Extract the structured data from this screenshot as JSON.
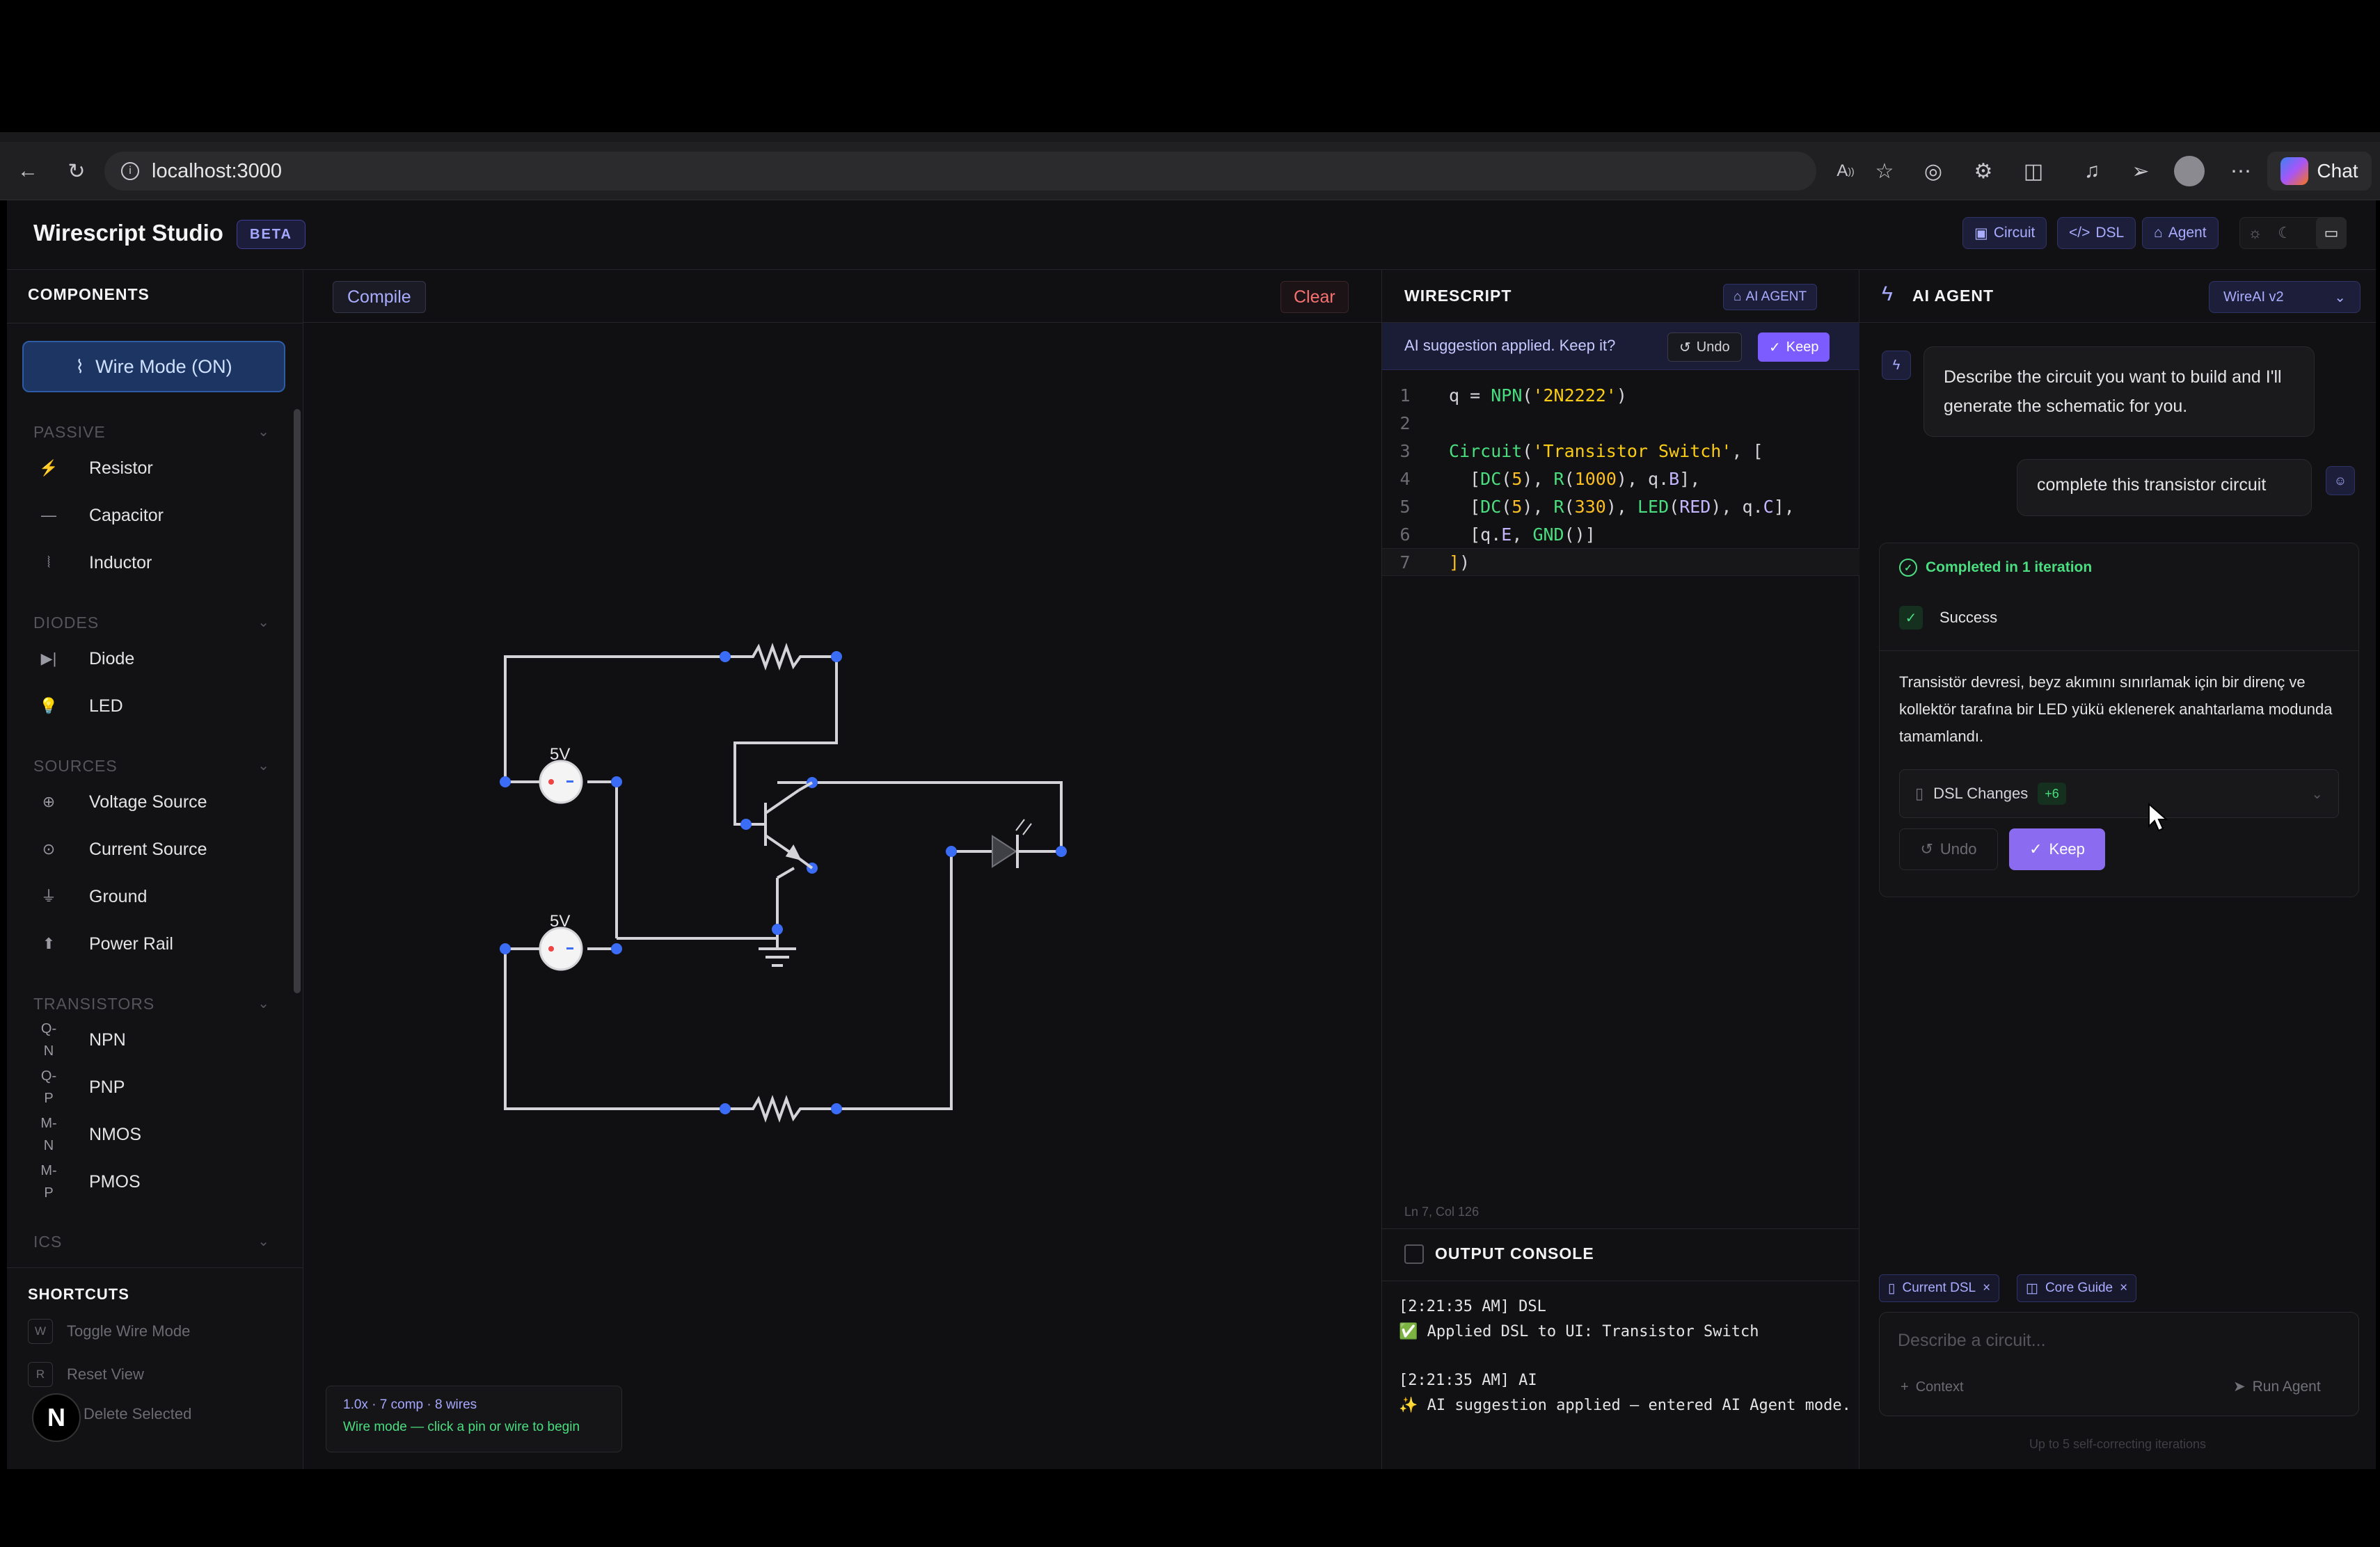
{
  "browser": {
    "url": "localhost:3000",
    "chat_label": "Chat",
    "toolbar_icons": [
      "back-icon",
      "reload-icon",
      "info-icon",
      "read-aloud-icon",
      "favorite-icon",
      "extension-icon",
      "puzzle-icon",
      "split-screen-icon",
      "media-icon",
      "send-icon",
      "profile-avatar",
      "more-icon",
      "copilot-icon"
    ]
  },
  "app": {
    "title": "Wirescript Studio",
    "badge": "BETA",
    "modes": [
      {
        "label": "Circuit",
        "icon": "chip-icon"
      },
      {
        "label": "DSL",
        "icon": "code-icon"
      },
      {
        "label": "Agent",
        "icon": "robot-icon"
      }
    ],
    "theme_icons": [
      "sun-icon",
      "moon-icon",
      "monitor-icon"
    ]
  },
  "sidebar": {
    "title": "COMPONENTS",
    "wire_mode_label": "Wire Mode (ON)",
    "groups": [
      {
        "name": "PASSIVE",
        "items": [
          {
            "label": "Resistor",
            "icon": "⚡",
            "icon_name": "resistor-icon"
          },
          {
            "label": "Capacitor",
            "icon": "—",
            "icon_name": "capacitor-icon"
          },
          {
            "label": "Inductor",
            "icon": "⦚",
            "icon_name": "inductor-icon"
          }
        ]
      },
      {
        "name": "DIODES",
        "items": [
          {
            "label": "Diode",
            "icon": "▶|",
            "icon_name": "diode-icon"
          },
          {
            "label": "LED",
            "icon": "💡",
            "icon_name": "led-icon"
          }
        ]
      },
      {
        "name": "SOURCES",
        "items": [
          {
            "label": "Voltage Source",
            "icon": "⊕",
            "icon_name": "voltage-source-icon"
          },
          {
            "label": "Current Source",
            "icon": "⊙",
            "icon_name": "current-source-icon"
          },
          {
            "label": "Ground",
            "icon": "⏚",
            "icon_name": "ground-icon"
          },
          {
            "label": "Power Rail",
            "icon": "⬆",
            "icon_name": "power-rail-icon"
          }
        ]
      },
      {
        "name": "TRANSISTORS",
        "items": [
          {
            "label": "NPN",
            "icon": "Q-\nN",
            "icon_name": "npn-icon"
          },
          {
            "label": "PNP",
            "icon": "Q-\nP",
            "icon_name": "pnp-icon"
          },
          {
            "label": "NMOS",
            "icon": "M-\nN",
            "icon_name": "nmos-icon"
          },
          {
            "label": "PMOS",
            "icon": "M-\nP",
            "icon_name": "pmos-icon"
          }
        ]
      },
      {
        "name": "ICS",
        "items": []
      }
    ],
    "shortcuts_title": "SHORTCUTS",
    "shortcuts": [
      {
        "key": "W",
        "label": "Toggle Wire Mode"
      },
      {
        "key": "R",
        "label": "Reset View"
      },
      {
        "key": "",
        "label": "Delete Selected"
      }
    ],
    "avatar_letter": "N"
  },
  "canvas": {
    "compile_label": "Compile",
    "clear_label": "Clear",
    "source1_label": "5V",
    "source2_label": "5V",
    "status_stats": "1.0x · 7 comp · 8 wires",
    "status_hint": "Wire mode — click a pin or wire to begin"
  },
  "wirescript": {
    "title": "WIRESCRIPT",
    "mode_badge": "AI AGENT",
    "suggestion_text": "AI suggestion applied. Keep it?",
    "undo_label": "Undo",
    "keep_label": "Keep",
    "code_lines": [
      {
        "n": "1",
        "html": "q = <span class=\"tk-fn\">NPN</span>(<span class=\"tk-str\">'2N2222'</span>)"
      },
      {
        "n": "2",
        "html": ""
      },
      {
        "n": "3",
        "html": "<span class=\"tk-fn\">Circuit</span>(<span class=\"tk-str\">'Transistor Switch'</span>, ["
      },
      {
        "n": "4",
        "html": "  [<span class=\"tk-fn\">DC</span>(<span class=\"tk-num\">5</span>), <span class=\"tk-fn\">R</span>(<span class=\"tk-num\">1000</span>), q.<span class=\"tk-var\">B</span>],"
      },
      {
        "n": "5",
        "html": "  [<span class=\"tk-fn\">DC</span>(<span class=\"tk-num\">5</span>), <span class=\"tk-fn\">R</span>(<span class=\"tk-num\">330</span>), <span class=\"tk-fn\">LED</span>(<span class=\"tk-var\">RED</span>), q.<span class=\"tk-var\">C</span>],"
      },
      {
        "n": "6",
        "html": "  [q.<span class=\"tk-var\">E</span>, <span class=\"tk-fn\">GND</span>()]"
      },
      {
        "n": "7",
        "html": "<span class=\"tk-num\">]</span>)"
      }
    ],
    "code_plain": [
      "q = NPN('2N2222')",
      "",
      "Circuit('Transistor Switch', [",
      "  [DC(5), R(1000), q.B],",
      "  [DC(5), R(330), LED(RED), q.C],",
      "  [q.E, GND()]",
      "])"
    ],
    "cursor_position": "Ln 7, Col 126",
    "console_title": "OUTPUT CONSOLE",
    "console_lines": [
      "[2:21:35 AM] DSL",
      "✅ Applied DSL to UI: Transistor Switch",
      "",
      "[2:21:35 AM] AI",
      "✨ AI suggestion applied — entered AI Agent mode."
    ]
  },
  "agent": {
    "title": "AI AGENT",
    "model": "WireAI v2",
    "bot_message": "Describe the circuit you want to build and I'll generate the schematic for you.",
    "user_message": "complete this transistor circuit",
    "completed_label": "Completed in 1 iteration",
    "success_label": "Success",
    "result_text": "Transistör devresi, beyz akımını sınırlamak için bir direnç ve kollektör tarafına bir LED yükü eklenerek anahtarlama modunda tamamlandı.",
    "dsl_changes_label": "DSL Changes",
    "dsl_changes_count": "+6",
    "undo_label": "Undo",
    "keep_label": "Keep",
    "context_chips": [
      "Current DSL",
      "Core Guide"
    ],
    "prompt_placeholder": "Describe a circuit...",
    "context_label": "Context",
    "run_label": "Run Agent",
    "iterations_note": "Up to 5 self-correcting iterations"
  },
  "colors": {
    "accent": "#7c5cff",
    "wire": "#d4d4d8",
    "node": "#3b6cf6",
    "success": "#4ade80",
    "danger": "#f87171"
  }
}
